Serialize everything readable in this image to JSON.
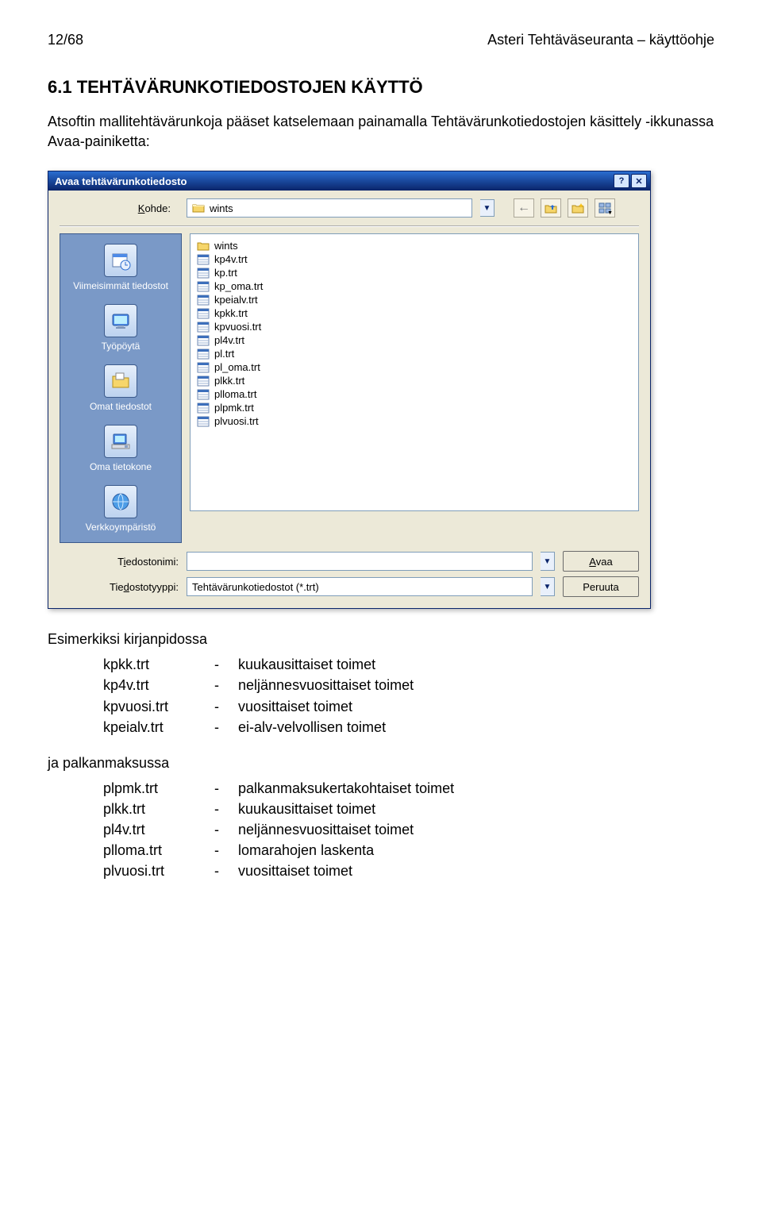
{
  "header": {
    "page_num": "12/68",
    "doc_title": "Asteri Tehtäväseuranta – käyttöohje"
  },
  "section": {
    "title": "6.1 TEHTÄVÄRUNKOTIEDOSTOJEN KÄYTTÖ",
    "intro": "Atsoftin mallitehtävärunkoja pääset katselemaan painamalla Tehtävärunkotiedostojen käsittely -ikkunassa Avaa-painiketta:"
  },
  "dialog": {
    "title": "Avaa tehtävärunkotiedosto",
    "kohde_label": "Kohde:",
    "kohde_value": "wints",
    "places": {
      "recent": "Viimeisimmät tiedostot",
      "desktop": "Työpöytä",
      "mydocs": "Omat tiedostot",
      "mycomp": "Oma tietokone",
      "network": "Verkkoympäristö"
    },
    "files": [
      {
        "name": "wints",
        "type": "folder"
      },
      {
        "name": "kp4v.trt",
        "type": "trt"
      },
      {
        "name": "kp.trt",
        "type": "trt"
      },
      {
        "name": "kp_oma.trt",
        "type": "trt"
      },
      {
        "name": "kpeialv.trt",
        "type": "trt"
      },
      {
        "name": "kpkk.trt",
        "type": "trt"
      },
      {
        "name": "kpvuosi.trt",
        "type": "trt"
      },
      {
        "name": "pl4v.trt",
        "type": "trt"
      },
      {
        "name": "pl.trt",
        "type": "trt"
      },
      {
        "name": "pl_oma.trt",
        "type": "trt"
      },
      {
        "name": "plkk.trt",
        "type": "trt"
      },
      {
        "name": "plloma.trt",
        "type": "trt"
      },
      {
        "name": "plpmk.trt",
        "type": "trt"
      },
      {
        "name": "plvuosi.trt",
        "type": "trt"
      }
    ],
    "filename_label": "Tiedostonimi:",
    "filename_value": "",
    "filetype_label": "Tiedostotyyppi:",
    "filetype_value": "Tehtävärunkotiedostot (*.trt)",
    "open_btn": "Avaa",
    "cancel_btn": "Peruuta"
  },
  "examples": {
    "kp_title": "Esimerkiksi kirjanpidossa",
    "kp": [
      {
        "file": "kpkk.trt",
        "desc": "kuukausittaiset toimet"
      },
      {
        "file": "kp4v.trt",
        "desc": "neljännesvuosittaiset toimet"
      },
      {
        "file": "kpvuosi.trt",
        "desc": "vuosittaiset toimet"
      },
      {
        "file": "kpeialv.trt",
        "desc": "ei-alv-velvollisen toimet"
      }
    ],
    "pl_title": "ja palkanmaksussa",
    "pl": [
      {
        "file": "plpmk.trt",
        "desc": "palkanmaksukertakohtaiset toimet"
      },
      {
        "file": "plkk.trt",
        "desc": "kuukausittaiset toimet"
      },
      {
        "file": "pl4v.trt",
        "desc": "neljännesvuosittaiset toimet"
      },
      {
        "file": "plloma.trt",
        "desc": "lomarahojen laskenta"
      },
      {
        "file": "plvuosi.trt",
        "desc": "vuosittaiset toimet"
      }
    ]
  },
  "dash": "-"
}
